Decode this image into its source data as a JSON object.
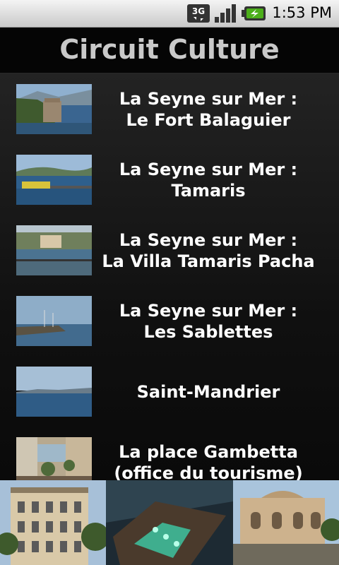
{
  "status_bar": {
    "network": "3G",
    "time": "1:53 PM",
    "icons": [
      "network-3g-icon",
      "signal-icon",
      "battery-charging-icon"
    ]
  },
  "header": {
    "title": "Circuit Culture"
  },
  "list": {
    "items": [
      {
        "line1": "La Seyne sur Mer :",
        "line2": "Le Fort Balaguier",
        "thumb": "fort-balaguier-photo"
      },
      {
        "line1": "La Seyne sur Mer :",
        "line2": "Tamaris",
        "thumb": "tamaris-photo"
      },
      {
        "line1": "La Seyne sur Mer :",
        "line2": "La Villa Tamaris Pacha",
        "thumb": "villa-tamaris-pacha-photo"
      },
      {
        "line1": "La Seyne sur Mer :",
        "line2": "Les Sablettes",
        "thumb": "les-sablettes-photo"
      },
      {
        "line1": "Saint-Mandrier",
        "line2": "",
        "thumb": "saint-mandrier-photo"
      },
      {
        "line1": "La place Gambetta",
        "line2": "(office du tourisme)",
        "thumb": "place-gambetta-photo"
      }
    ]
  },
  "banner": {
    "images": [
      "historic-building-photo",
      "night-stadium-aerial-photo",
      "town-square-building-photo"
    ]
  },
  "colors": {
    "status_bar": "#d9d9d9",
    "title_text": "#c9c9c9",
    "list_background": "#151515",
    "item_text": "#ffffff",
    "battery_green": "#4caf1a"
  }
}
